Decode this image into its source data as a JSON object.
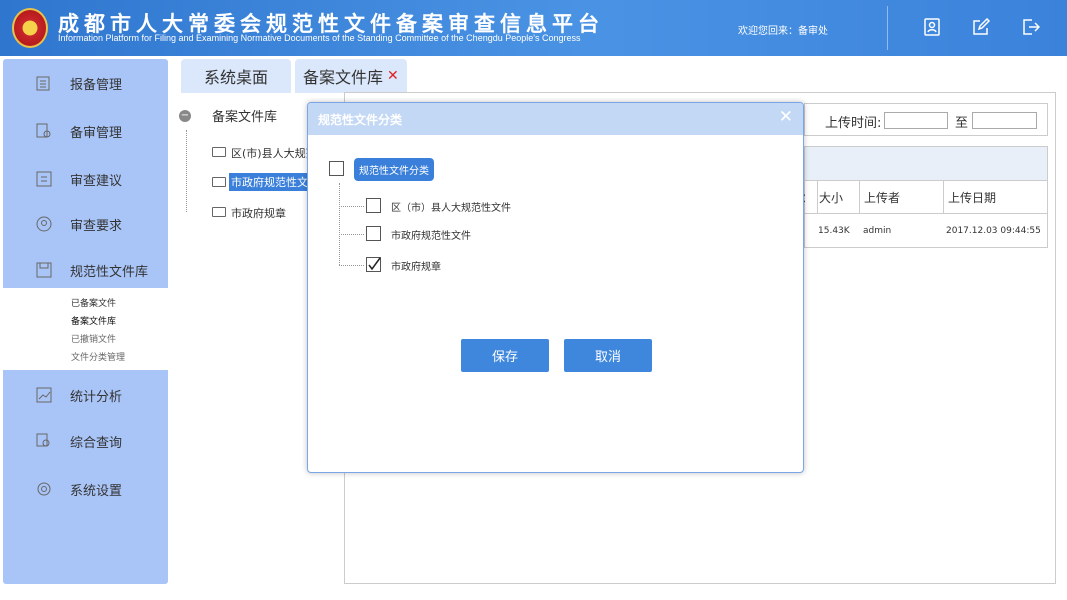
{
  "header": {
    "title": "成都市人大常委会规范性文件备案审查信息平台",
    "subtitle": "Information Platform for Filing and Examining Normative Documents of the Standing Committee of the Chengdu People's Congress",
    "welcome": "欢迎您回来：备审处"
  },
  "sidebar": {
    "items": [
      "报备管理",
      "备审管理",
      "审查建议",
      "审查要求",
      "规范性文件库",
      "统计分析",
      "综合查询",
      "系统设置"
    ],
    "submenu": [
      "已备案文件",
      "备案文件库",
      "已撤销文件",
      "文件分类管理"
    ]
  },
  "tabs": [
    "系统桌面",
    "备案文件库"
  ],
  "tree": {
    "root": "备案文件库",
    "items": [
      "区(市)县人大规范",
      "市政府规范性文件",
      "市政府规章"
    ]
  },
  "filter": {
    "label": "上传时间:",
    "to": "至"
  },
  "table": {
    "headers": [
      "大小",
      "上传者",
      "上传日期"
    ],
    "row": [
      "15.43K",
      "admin",
      "2017.12.03 09:44:55"
    ],
    "partial": "："
  },
  "modal": {
    "title": "规范性文件分类",
    "root": "规范性文件分类",
    "items": [
      {
        "label": "区（市）县人大规范性文件",
        "checked": false
      },
      {
        "label": "市政府规范性文件",
        "checked": false
      },
      {
        "label": "市政府规章",
        "checked": true
      }
    ],
    "save": "保存",
    "cancel": "取消"
  }
}
